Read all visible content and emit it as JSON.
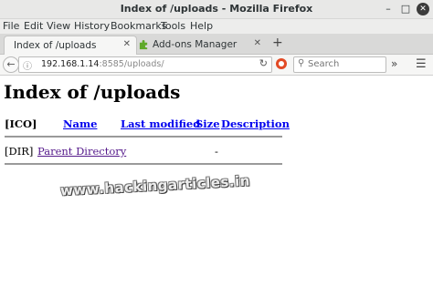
{
  "window": {
    "title": "Index of /uploads - Mozilla Firefox"
  },
  "menu": [
    "File",
    "Edit",
    "View",
    "History",
    "Bookmarks",
    "Tools",
    "Help"
  ],
  "tabs": [
    {
      "label": "Index of /uploads",
      "active": true
    },
    {
      "label": "Add-ons Manager",
      "active": false
    }
  ],
  "navbar": {
    "url_host": "192.168.1.14",
    "url_rest": ":8585/uploads/",
    "search_placeholder": "Search"
  },
  "page": {
    "heading": "Index of /uploads",
    "columns": [
      "[ICO]",
      "Name",
      "Last modified",
      "Size",
      "Description"
    ],
    "rows": [
      {
        "icon": "[DIR]",
        "name": "Parent Directory",
        "last_modified": "",
        "size": "-",
        "description": ""
      }
    ]
  },
  "watermark": "www.hackingarticles.in",
  "icons": {
    "back": "back-arrow-icon",
    "info": "info-icon",
    "reload": "reload-icon",
    "search": "search-icon",
    "overflow": "overflow-chevron-icon",
    "menu": "hamburger-menu-icon",
    "addons_tab": "puzzle-piece-icon"
  }
}
